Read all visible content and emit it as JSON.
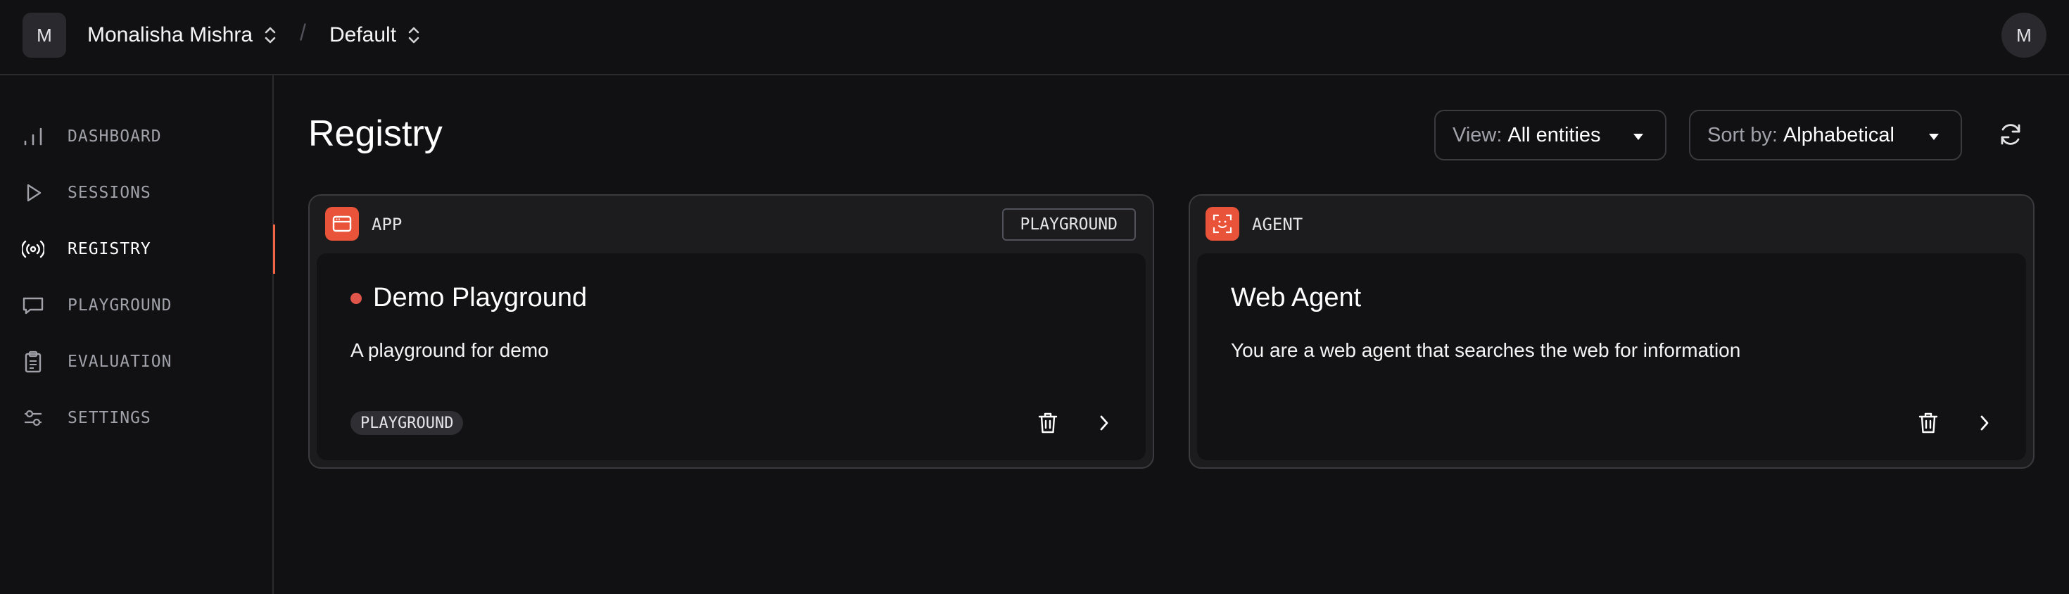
{
  "header": {
    "workspace_avatar": "M",
    "workspace_name": "Monalisha Mishra",
    "separator": "/",
    "project_name": "Default",
    "user_avatar": "M"
  },
  "sidebar": {
    "items": [
      {
        "label": "DASHBOARD",
        "icon": "bar-chart-icon"
      },
      {
        "label": "SESSIONS",
        "icon": "play-icon"
      },
      {
        "label": "REGISTRY",
        "icon": "broadcast-icon",
        "active": true
      },
      {
        "label": "PLAYGROUND",
        "icon": "message-icon"
      },
      {
        "label": "EVALUATION",
        "icon": "clipboard-icon"
      },
      {
        "label": "SETTINGS",
        "icon": "sliders-icon"
      }
    ],
    "active_color": "#f26444"
  },
  "main": {
    "title": "Registry",
    "view_filter": {
      "prefix": "View:",
      "value": "All entities"
    },
    "sort_filter": {
      "prefix": "Sort by:",
      "value": "Alphabetical"
    }
  },
  "cards": [
    {
      "type": "APP",
      "header_tag": "PLAYGROUND",
      "title": "Demo Playground",
      "description": "A playground for demo",
      "pill": "PLAYGROUND",
      "status_color": "#e0564a"
    },
    {
      "type": "AGENT",
      "title": "Web Agent",
      "description": "You are a web agent that searches the web for information"
    }
  ],
  "colors": {
    "background": "#111113",
    "accent": "#e9533a",
    "card": "#1c1c1f",
    "border": "#3a3a3f"
  }
}
